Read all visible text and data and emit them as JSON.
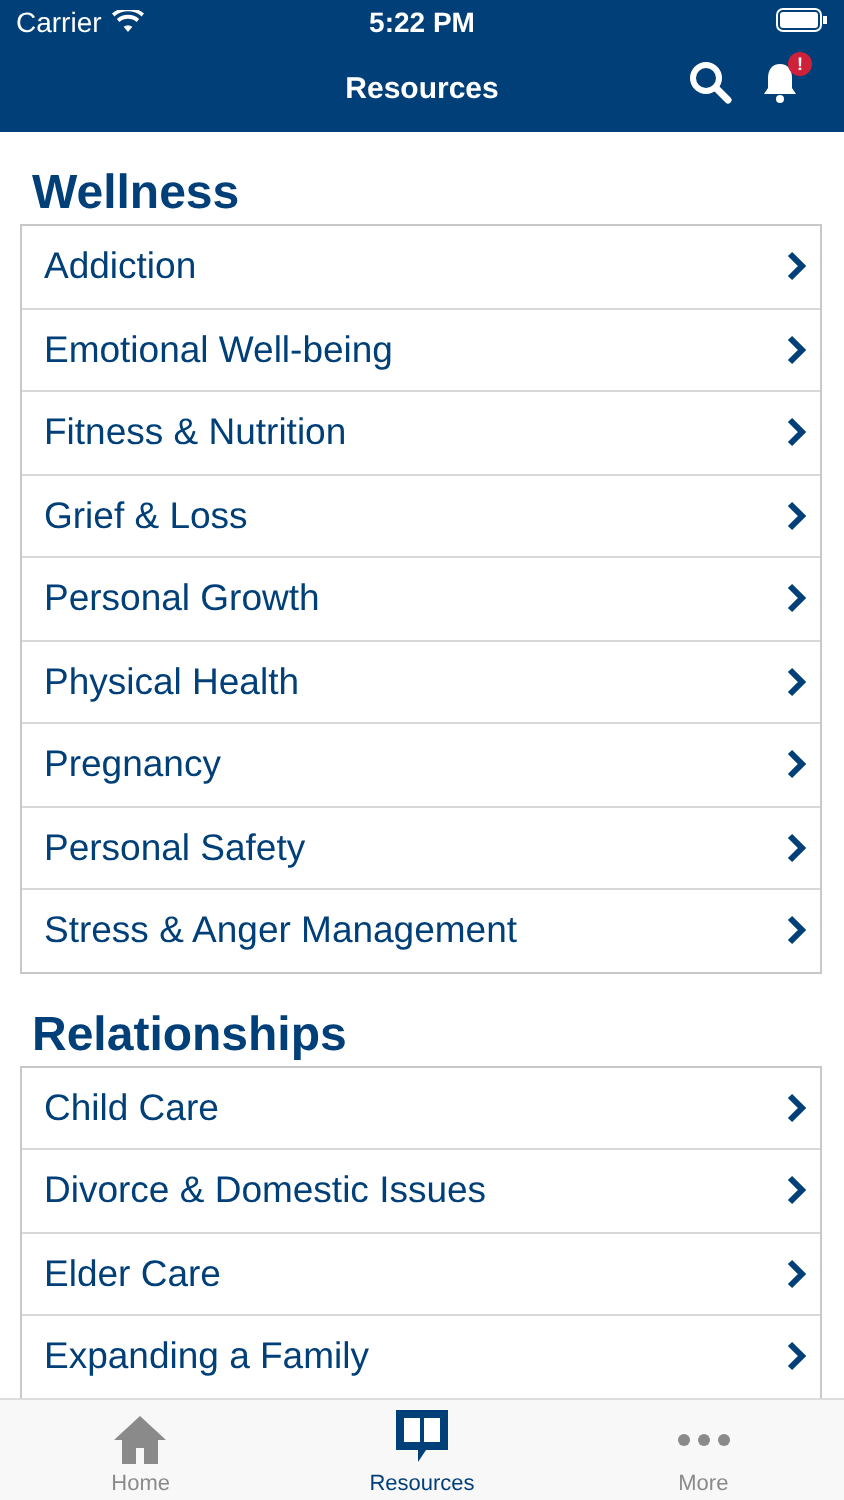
{
  "status_bar": {
    "carrier": "Carrier",
    "time": "5:22 PM"
  },
  "nav_bar": {
    "title": "Resources",
    "notification_badge": "!"
  },
  "sections": [
    {
      "title": "Wellness",
      "items": [
        "Addiction",
        "Emotional Well-being",
        "Fitness & Nutrition",
        "Grief & Loss",
        "Personal Growth",
        "Physical Health",
        "Pregnancy",
        "Personal Safety",
        "Stress & Anger Management"
      ]
    },
    {
      "title": "Relationships",
      "items": [
        "Child Care",
        "Divorce & Domestic Issues",
        "Elder Care",
        "Expanding a Family"
      ]
    }
  ],
  "tab_bar": [
    {
      "label": "Home",
      "kind": "home",
      "selected": false
    },
    {
      "label": "Resources",
      "kind": "book",
      "selected": true
    },
    {
      "label": "More",
      "kind": "more",
      "selected": false
    }
  ]
}
